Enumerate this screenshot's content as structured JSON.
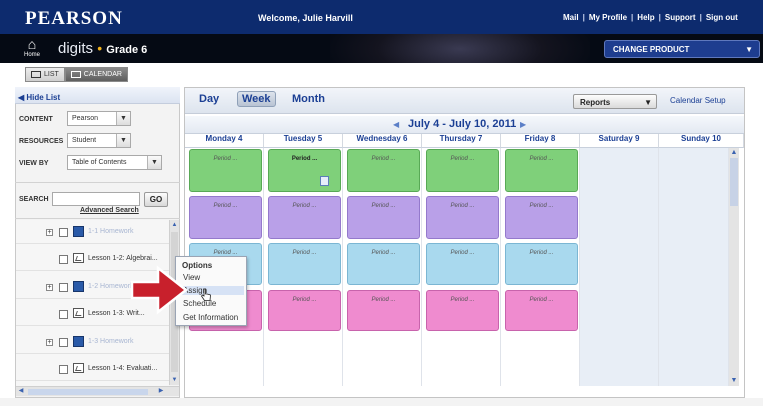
{
  "header": {
    "logo": "PEARSON",
    "welcome": "Welcome, Julie Harvill",
    "links": [
      "Mail",
      "My Profile",
      "Help",
      "Support",
      "Sign out"
    ],
    "home_label": "Home",
    "brand": "digits",
    "grade": "Grade 6",
    "change_product": "CHANGE PRODUCT"
  },
  "view_toggle": {
    "list": "LIST",
    "calendar": "CALENDAR"
  },
  "left_panel": {
    "hide_list": "Hide List",
    "filters": [
      {
        "label": "CONTENT",
        "value": "Pearson"
      },
      {
        "label": "RESOURCES",
        "value": "Student"
      },
      {
        "label": "VIEW BY",
        "value": "Table of Contents"
      }
    ],
    "search_label": "SEARCH",
    "search_value": "",
    "go": "GO",
    "advanced_search": "Advanced Search",
    "tree": [
      {
        "type": "homework",
        "text": "1-1 Homework"
      },
      {
        "type": "lesson",
        "text": "Lesson 1-2: Algebrai..."
      },
      {
        "type": "homework",
        "text": "1-2 Homework"
      },
      {
        "type": "lesson",
        "text": "Lesson 1-3: Writ..."
      },
      {
        "type": "homework",
        "text": "1-3 Homework"
      },
      {
        "type": "lesson",
        "text": "Lesson 1-4: Evaluati..."
      }
    ]
  },
  "options_popup": {
    "title": "Options",
    "items": [
      "View",
      "Assign",
      "Schedule",
      "Get Information"
    ],
    "highlighted": "Assign"
  },
  "calendar": {
    "tabs": [
      "Day",
      "Week",
      "Month"
    ],
    "active_tab": "Week",
    "reports": "Reports",
    "setup": "Calendar Setup",
    "date_range": "July 4 - July 10, 2011",
    "days": [
      "Monday 4",
      "Tuesday 5",
      "Wednesday 6",
      "Thursday 7",
      "Friday 8",
      "Saturday 9",
      "Sunday 10"
    ],
    "period_label": "Period ...",
    "colors": {
      "green": "#7fd07a",
      "purple": "#b9a0e8",
      "blue": "#a9d9ee",
      "pink": "#ef8bcf"
    }
  }
}
